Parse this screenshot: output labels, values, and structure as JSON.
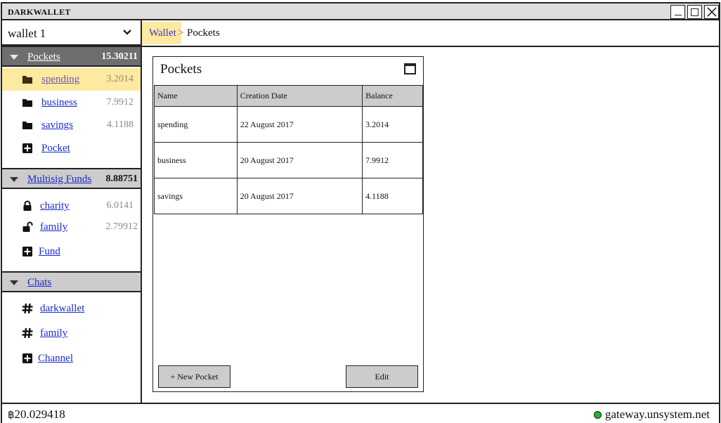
{
  "app": {
    "title": "DARKWALLET"
  },
  "wallet_selector": {
    "value": "wallet 1"
  },
  "sidebar": {
    "pockets": {
      "label": "Pockets",
      "total": "15.30211",
      "items": [
        {
          "label": "spending",
          "amount": "3.2014",
          "icon": "folder-icon",
          "active": true
        },
        {
          "label": "business",
          "amount": "7.9912",
          "icon": "folder-icon"
        },
        {
          "label": "savings",
          "amount": "4.1188",
          "icon": "folder-icon"
        }
      ],
      "add_label": "Pocket"
    },
    "multisig": {
      "label": "Multisig Funds",
      "total": "8.88751",
      "items": [
        {
          "label": "charity",
          "amount": "6.0141",
          "icon": "lock-closed-icon"
        },
        {
          "label": "family",
          "amount": "2.79912",
          "icon": "lock-open-icon"
        }
      ],
      "add_label": "Fund"
    },
    "chats": {
      "label": "Chats",
      "items": [
        {
          "label": "darkwallet",
          "icon": "hash-icon"
        },
        {
          "label": "family",
          "icon": "hash-icon"
        }
      ],
      "add_label": "Channel"
    }
  },
  "breadcrumb": {
    "root": "Wallet",
    "separator": ">",
    "current": "Pockets"
  },
  "panel": {
    "title": "Pockets",
    "columns": [
      "Name",
      "Creation Date",
      "Balance"
    ],
    "rows": [
      [
        "spending",
        "22 August 2017",
        "3.2014"
      ],
      [
        "business",
        "20 August 2017",
        "7.9912"
      ],
      [
        "savings",
        "20 August 2017",
        "4.1188"
      ]
    ],
    "new_button": "+ New Pocket",
    "edit_button": "Edit"
  },
  "status": {
    "currency_symbol": "฿",
    "balance": "20.029418",
    "gateway": "gateway.unsystem.net",
    "gateway_status_color": "#1fb32a"
  },
  "colors": {
    "active_highlight": "#fde9a0",
    "link": "#1a2ad0",
    "section_dark": "#6e6e6e",
    "section_light": "#cccccc"
  }
}
